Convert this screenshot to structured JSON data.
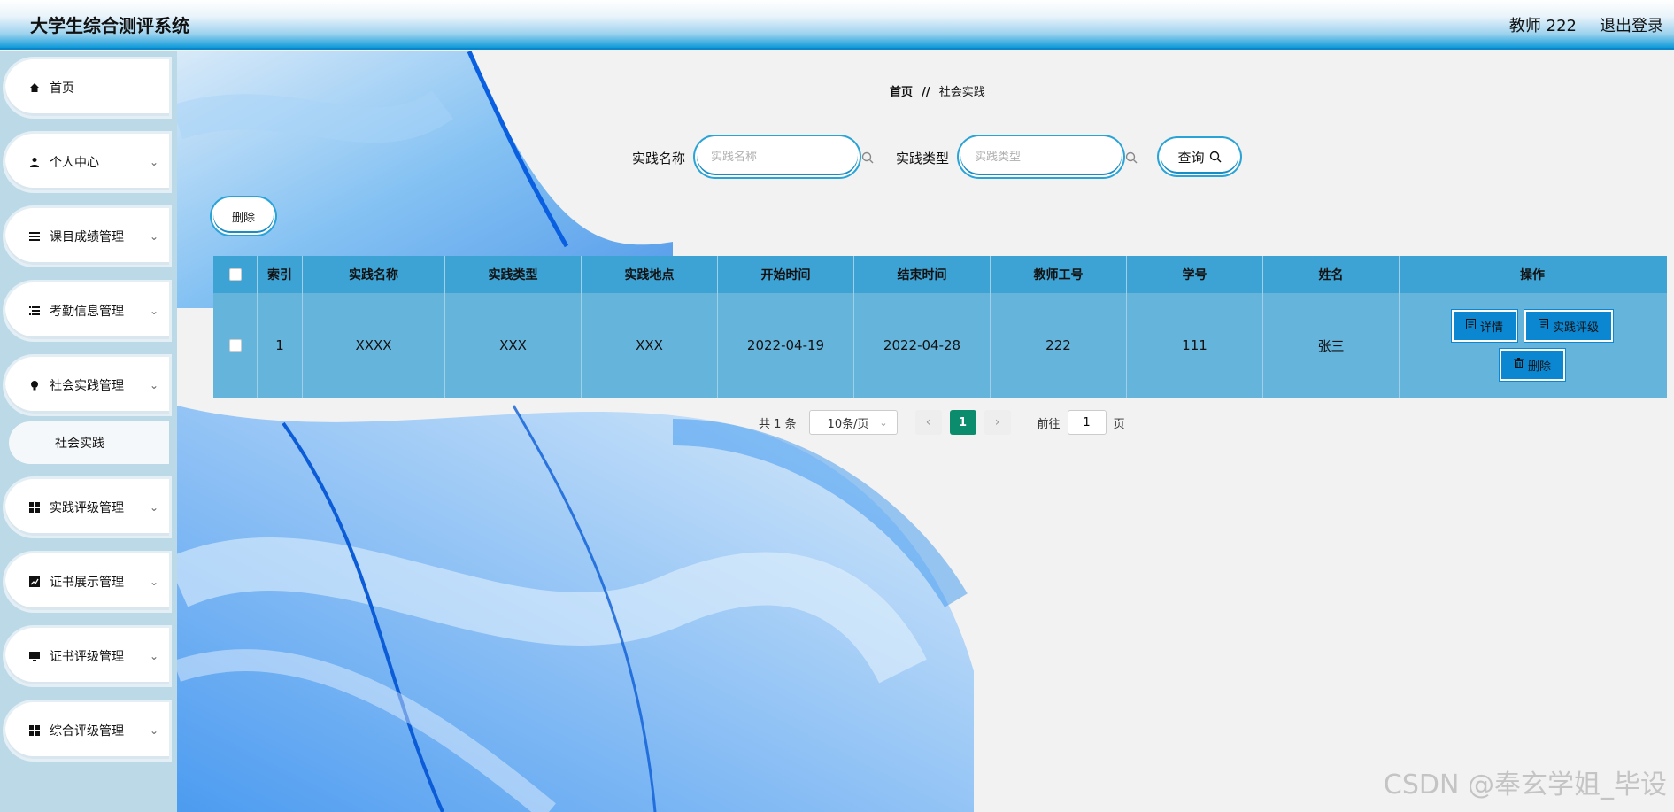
{
  "header": {
    "title": "大学生综合测评系统",
    "user": "教师 222",
    "logout": "退出登录"
  },
  "sidebar": {
    "items": [
      {
        "label": "首页",
        "icon": "home-icon"
      },
      {
        "label": "个人中心",
        "icon": "user-icon"
      },
      {
        "label": "课目成绩管理",
        "icon": "list-icon"
      },
      {
        "label": "考勤信息管理",
        "icon": "list-indent-icon"
      },
      {
        "label": "社会实践管理",
        "icon": "bulb-icon"
      },
      {
        "label": "社会实践",
        "icon": ""
      },
      {
        "label": "实践评级管理",
        "icon": "grid-icon"
      },
      {
        "label": "证书展示管理",
        "icon": "chart-icon"
      },
      {
        "label": "证书评级管理",
        "icon": "monitor-icon"
      },
      {
        "label": "综合评级管理",
        "icon": "grid-icon"
      }
    ]
  },
  "breadcrumb": {
    "home": "首页",
    "sep": "//",
    "current": "社会实践"
  },
  "search": {
    "name_label": "实践名称",
    "name_placeholder": "实践名称",
    "type_label": "实践类型",
    "type_placeholder": "实践类型",
    "query_button": "查询"
  },
  "toolbar": {
    "delete_button": "删除"
  },
  "table": {
    "headers": [
      "索引",
      "实践名称",
      "实践类型",
      "实践地点",
      "开始时间",
      "结束时间",
      "教师工号",
      "学号",
      "姓名",
      "操作"
    ],
    "rows": [
      {
        "index": "1",
        "name": "XXXX",
        "type": "XXX",
        "place": "XXX",
        "start": "2022-04-19",
        "end": "2022-04-28",
        "teacher_id": "222",
        "student_id": "111",
        "student_name": "张三"
      }
    ],
    "actions": {
      "detail": "详情",
      "rate": "实践评级",
      "delete": "删除"
    }
  },
  "pagination": {
    "total": "共 1 条",
    "page_size": "10条/页",
    "current_page": "1",
    "goto_label": "前往",
    "goto_value": "1",
    "page_unit": "页"
  },
  "watermark": "CSDN @奉玄学姐_毕设",
  "colors": {
    "header_blue": "#0f9ad9",
    "table_header": "#3da3d4",
    "table_row": "#65b4dc",
    "active_page": "#0a8c6d",
    "action_button": "#0b86d0"
  }
}
